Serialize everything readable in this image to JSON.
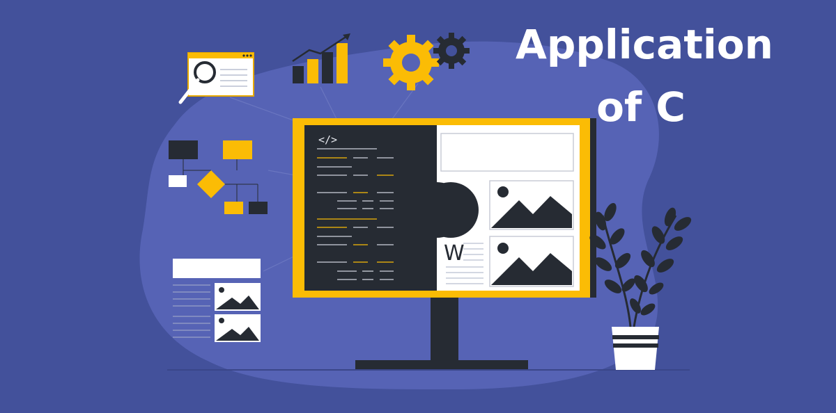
{
  "title": {
    "line1": "Application",
    "line2": "of C"
  },
  "monitor": {
    "code_tag": "</>",
    "doc_letter": "W"
  },
  "colors": {
    "background": "#43519b",
    "blob": "#5663b5",
    "accent": "#fbbc05",
    "dark": "#262b33",
    "white": "#ffffff"
  },
  "icons": [
    "magnifier-browser-icon",
    "bar-chart-trend-icon",
    "gear-icon",
    "flowchart-icon",
    "code-editor-icon",
    "image-placeholder-icon",
    "potted-plant-icon"
  ]
}
